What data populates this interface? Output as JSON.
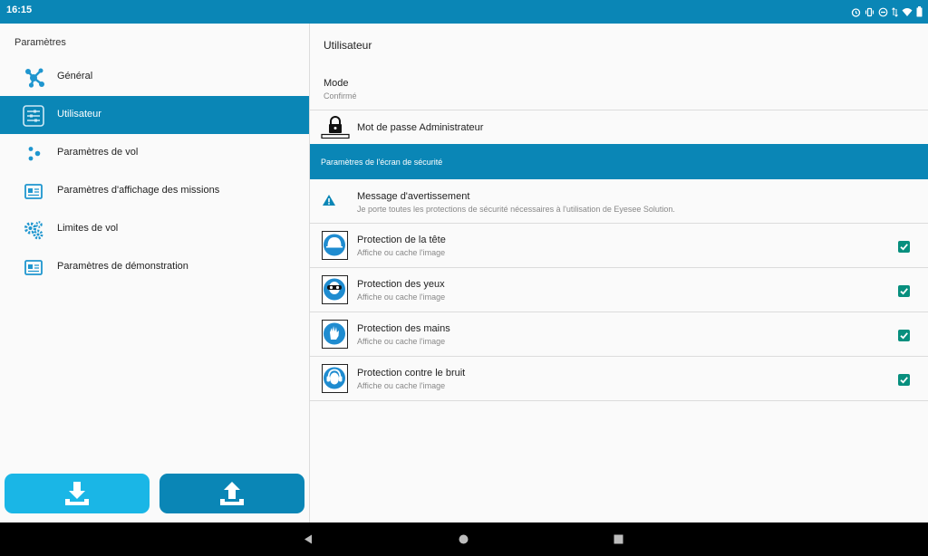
{
  "status_bar": {
    "time": "16:15",
    "icons": [
      "alarm-icon",
      "vibrate-icon",
      "do-not-disturb-icon",
      "data-arrows-icon",
      "wifi-icon",
      "battery-icon"
    ]
  },
  "sidebar": {
    "title": "Paramètres",
    "items": [
      {
        "label": "Général",
        "icon": "network-nodes-icon",
        "active": false
      },
      {
        "label": "Utilisateur",
        "icon": "user-settings-icon",
        "active": true
      },
      {
        "label": "Paramètres de vol",
        "icon": "dots-icon",
        "active": false
      },
      {
        "label": "Paramètres d'affichage des missions",
        "icon": "id-card-icon",
        "active": false
      },
      {
        "label": "Limites de vol",
        "icon": "gears-icon",
        "active": false
      },
      {
        "label": "Paramètres de démonstration",
        "icon": "id-card-icon",
        "active": false
      }
    ],
    "buttons": {
      "download_icon": "download-icon",
      "upload_icon": "upload-icon"
    }
  },
  "main": {
    "title": "Utilisateur",
    "mode": {
      "title": "Mode",
      "value": "Confirmé"
    },
    "admin_password": {
      "label": "Mot de passe Administrateur",
      "icon": "lock-icon"
    },
    "security_section": {
      "title": "Paramètres de l'écran de sécurité"
    },
    "warning": {
      "title": "Message d'avertissement",
      "text": "Je porte toutes les protections de sécurité nécessaires à l'utilisation de Eyesee Solution.",
      "icon": "warning-icon"
    },
    "protections": [
      {
        "title": "Protection de la tête",
        "subtitle": "Affiche ou cache l'image",
        "icon": "helmet-icon",
        "checked": true
      },
      {
        "title": "Protection des yeux",
        "subtitle": "Affiche ou cache l'image",
        "icon": "goggles-icon",
        "checked": true
      },
      {
        "title": "Protection des mains",
        "subtitle": "Affiche ou cache l'image",
        "icon": "gloves-icon",
        "checked": true
      },
      {
        "title": "Protection contre le bruit",
        "subtitle": "Affiche ou cache l'image",
        "icon": "ear-protection-icon",
        "checked": true
      }
    ]
  },
  "nav_bar": {
    "buttons": [
      "back-icon",
      "home-icon",
      "recents-icon"
    ]
  },
  "colors": {
    "primary": "#0a86b6",
    "light_blue": "#1ab6e6",
    "checkbox": "#088f7e",
    "icon_blue": "#1f96cf"
  }
}
